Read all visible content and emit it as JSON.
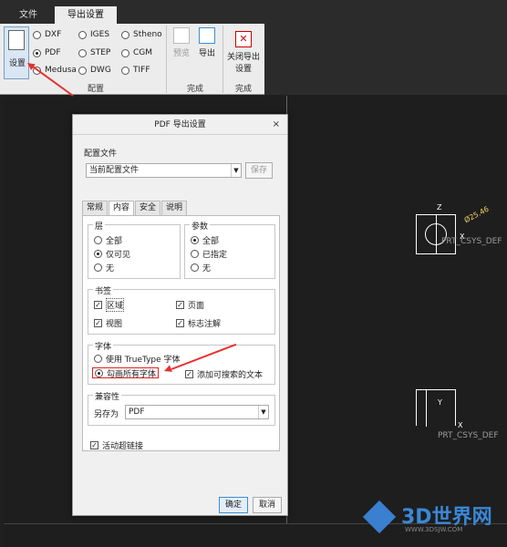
{
  "tabs": {
    "file": "文件",
    "export": "导出设置"
  },
  "ribbon": {
    "settings_label": "设置",
    "formats": [
      {
        "label": "DXF",
        "selected": false
      },
      {
        "label": "IGES",
        "selected": false
      },
      {
        "label": "Stheno",
        "selected": false
      },
      {
        "label": "PDF",
        "selected": true
      },
      {
        "label": "STEP",
        "selected": false
      },
      {
        "label": "CGM",
        "selected": false
      },
      {
        "label": "Medusa",
        "selected": false
      },
      {
        "label": "DWG",
        "selected": false
      },
      {
        "label": "TIFF",
        "selected": false
      }
    ],
    "group_config": "配置",
    "preview": "预览",
    "export": "导出",
    "group_finish1": "完成",
    "close_line1": "关闭导出",
    "close_line2": "设置",
    "group_finish2": "完成"
  },
  "canvas": {
    "csys_top": "PRT_CSYS_DEF",
    "csys_bottom": "PRT_CSYS_DEF",
    "z_label": "Z",
    "x_label": "X",
    "y_label": "Y",
    "dimension": "Ø25.46"
  },
  "dialog": {
    "title": "PDF 导出设置",
    "close": "×",
    "profile_label": "配置文件",
    "profile_value": "当前配置文件",
    "save": "保存",
    "tabs": [
      "常规",
      "内容",
      "安全",
      "说明"
    ],
    "layers": {
      "title": "层",
      "options": [
        "全部",
        "仅可见",
        "无"
      ],
      "selected": 1
    },
    "params": {
      "title": "参数",
      "options": [
        "全部",
        "已指定",
        "无"
      ],
      "selected": 0
    },
    "bookmarks": {
      "title": "书签",
      "items": [
        "区域",
        "页面",
        "视图",
        "标志注解"
      ]
    },
    "fonts": {
      "title": "字体",
      "truetype": "使用 TrueType 字体",
      "outline": "勾画所有字体",
      "searchable": "添加可搜索的文本"
    },
    "compat": {
      "title": "兼容性",
      "saveas_label": "另存为",
      "saveas_value": "PDF"
    },
    "hyperlink": "活动超链接",
    "ok": "确定",
    "cancel": "取消"
  },
  "watermark": {
    "brand": "3D世界网",
    "url": "WWW.3DSJW.COM"
  },
  "colors": {
    "accent": "#3b8fd6",
    "annotation": "#e53030",
    "dimension": "#f3d45c"
  }
}
